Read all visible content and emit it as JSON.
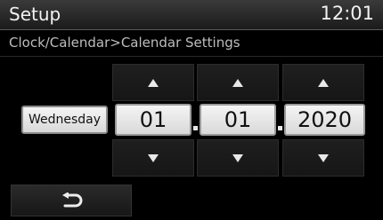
{
  "header": {
    "title": "Setup",
    "time": "12:01"
  },
  "breadcrumb": "Clock/Calendar>Calendar Settings",
  "calendar": {
    "weekday": "Wednesday",
    "month": "01",
    "day": "01",
    "year": "2020"
  },
  "icons": {
    "increment": "triangle-up",
    "decrement": "triangle-down",
    "back": "return-arrow"
  },
  "colors": {
    "field_bg": "#e8e8e8",
    "background": "#000000"
  }
}
